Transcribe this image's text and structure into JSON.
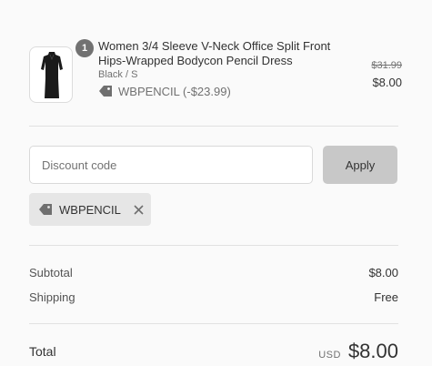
{
  "order_summary": {
    "product": {
      "quantity": "1",
      "title": "Women 3/4 Sleeve V-Neck Office Split Front Hips-Wrapped Bodycon Pencil Dress",
      "variant": "Black / S",
      "discount_label": "WBPENCIL (-$23.99)",
      "compare_price": "$31.99",
      "price": "$8.00",
      "thumbnail_icon": "black-dress-thumbnail"
    },
    "discount_form": {
      "placeholder": "Discount code",
      "value": "",
      "apply_label": "Apply"
    },
    "applied_code": {
      "code": "WBPENCIL",
      "tag_icon": "tag-icon",
      "remove_icon": "close-icon"
    },
    "totals": {
      "subtotal_label": "Subtotal",
      "subtotal_value": "$8.00",
      "shipping_label": "Shipping",
      "shipping_value": "Free",
      "total_label": "Total",
      "currency": "USD",
      "total_value": "$8.00"
    },
    "colors": {
      "background": "#fafafa",
      "button_disabled": "#c8c8c8",
      "tag_background": "#e6e6e6",
      "badge": "#727272"
    }
  }
}
